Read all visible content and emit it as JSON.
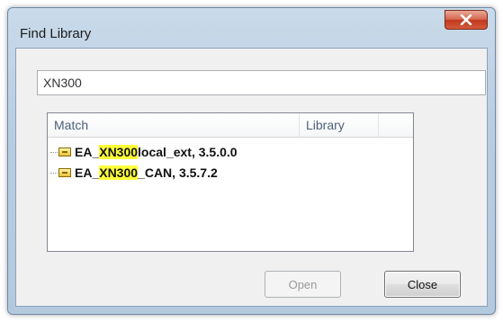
{
  "window": {
    "title": "Find Library",
    "close_icon": "close-x-icon"
  },
  "search": {
    "value": "XN300"
  },
  "list": {
    "columns": [
      "Match",
      "Library",
      ""
    ],
    "rows": [
      {
        "icon": "library-icon",
        "prefix": "EA_",
        "highlight": "XN300",
        "suffix": "local_ext, 3.5.0.0",
        "library": ""
      },
      {
        "icon": "library-icon",
        "prefix": "EA_",
        "highlight": "XN300",
        "suffix": "_CAN, 3.5.7.2",
        "library": ""
      }
    ]
  },
  "buttons": {
    "open_label": "Open",
    "close_label": "Close"
  },
  "colors": {
    "highlight": "#ffff3a",
    "close_button": "#d45a3c"
  }
}
